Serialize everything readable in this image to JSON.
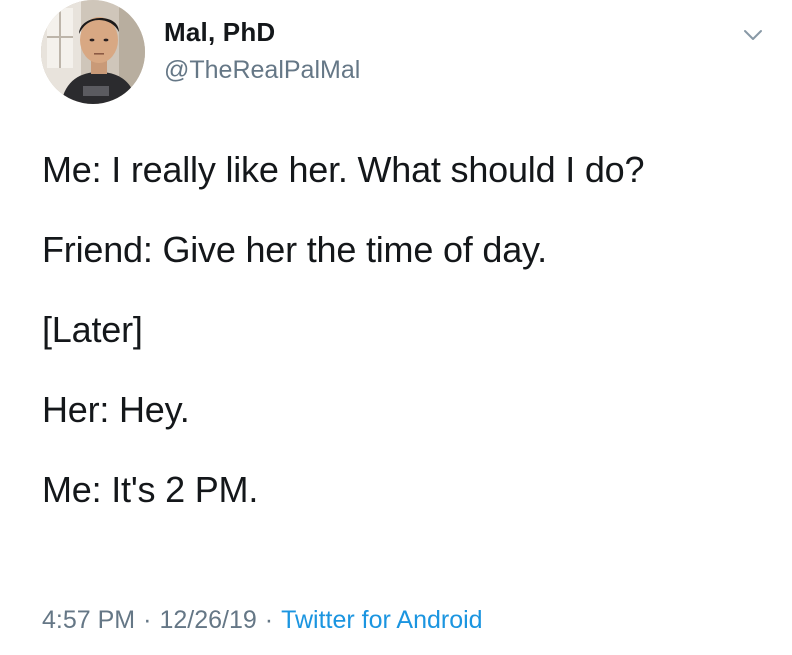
{
  "tweet": {
    "author": {
      "display_name": "Mal, PhD",
      "handle": "@TheRealPalMal"
    },
    "icons": {
      "menu": "chevron-down-icon",
      "avatar": "avatar"
    },
    "lines": [
      "Me: I really like her. What should I do?",
      "Friend: Give her the time of day.",
      "[Later]",
      "Her: Hey.",
      "Me: It's 2 PM."
    ],
    "meta": {
      "time": "4:57 PM",
      "date": "12/26/19",
      "separator": "·",
      "source": "Twitter for Android"
    },
    "colors": {
      "text": "#14171a",
      "secondary": "#657786",
      "link": "#1b95e0"
    }
  }
}
